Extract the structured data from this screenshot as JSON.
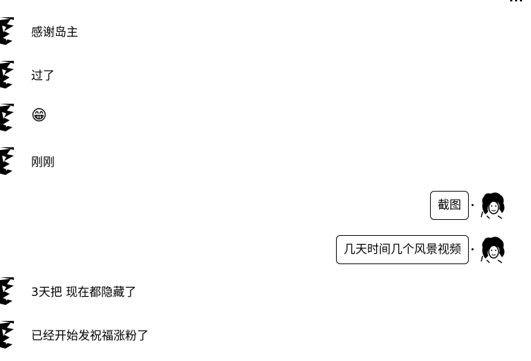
{
  "messages": [
    {
      "side": "left",
      "text": "感谢岛主"
    },
    {
      "side": "left",
      "text": "过了"
    },
    {
      "side": "left",
      "text": "😁"
    },
    {
      "side": "left",
      "text": "刚刚"
    },
    {
      "side": "right",
      "text": "截图"
    },
    {
      "side": "right",
      "text": "几天时间几个风景视频"
    },
    {
      "side": "left",
      "text": "3天把 现在都隐藏了"
    },
    {
      "side": "left",
      "text": "已经开始发祝福涨粉了"
    }
  ]
}
